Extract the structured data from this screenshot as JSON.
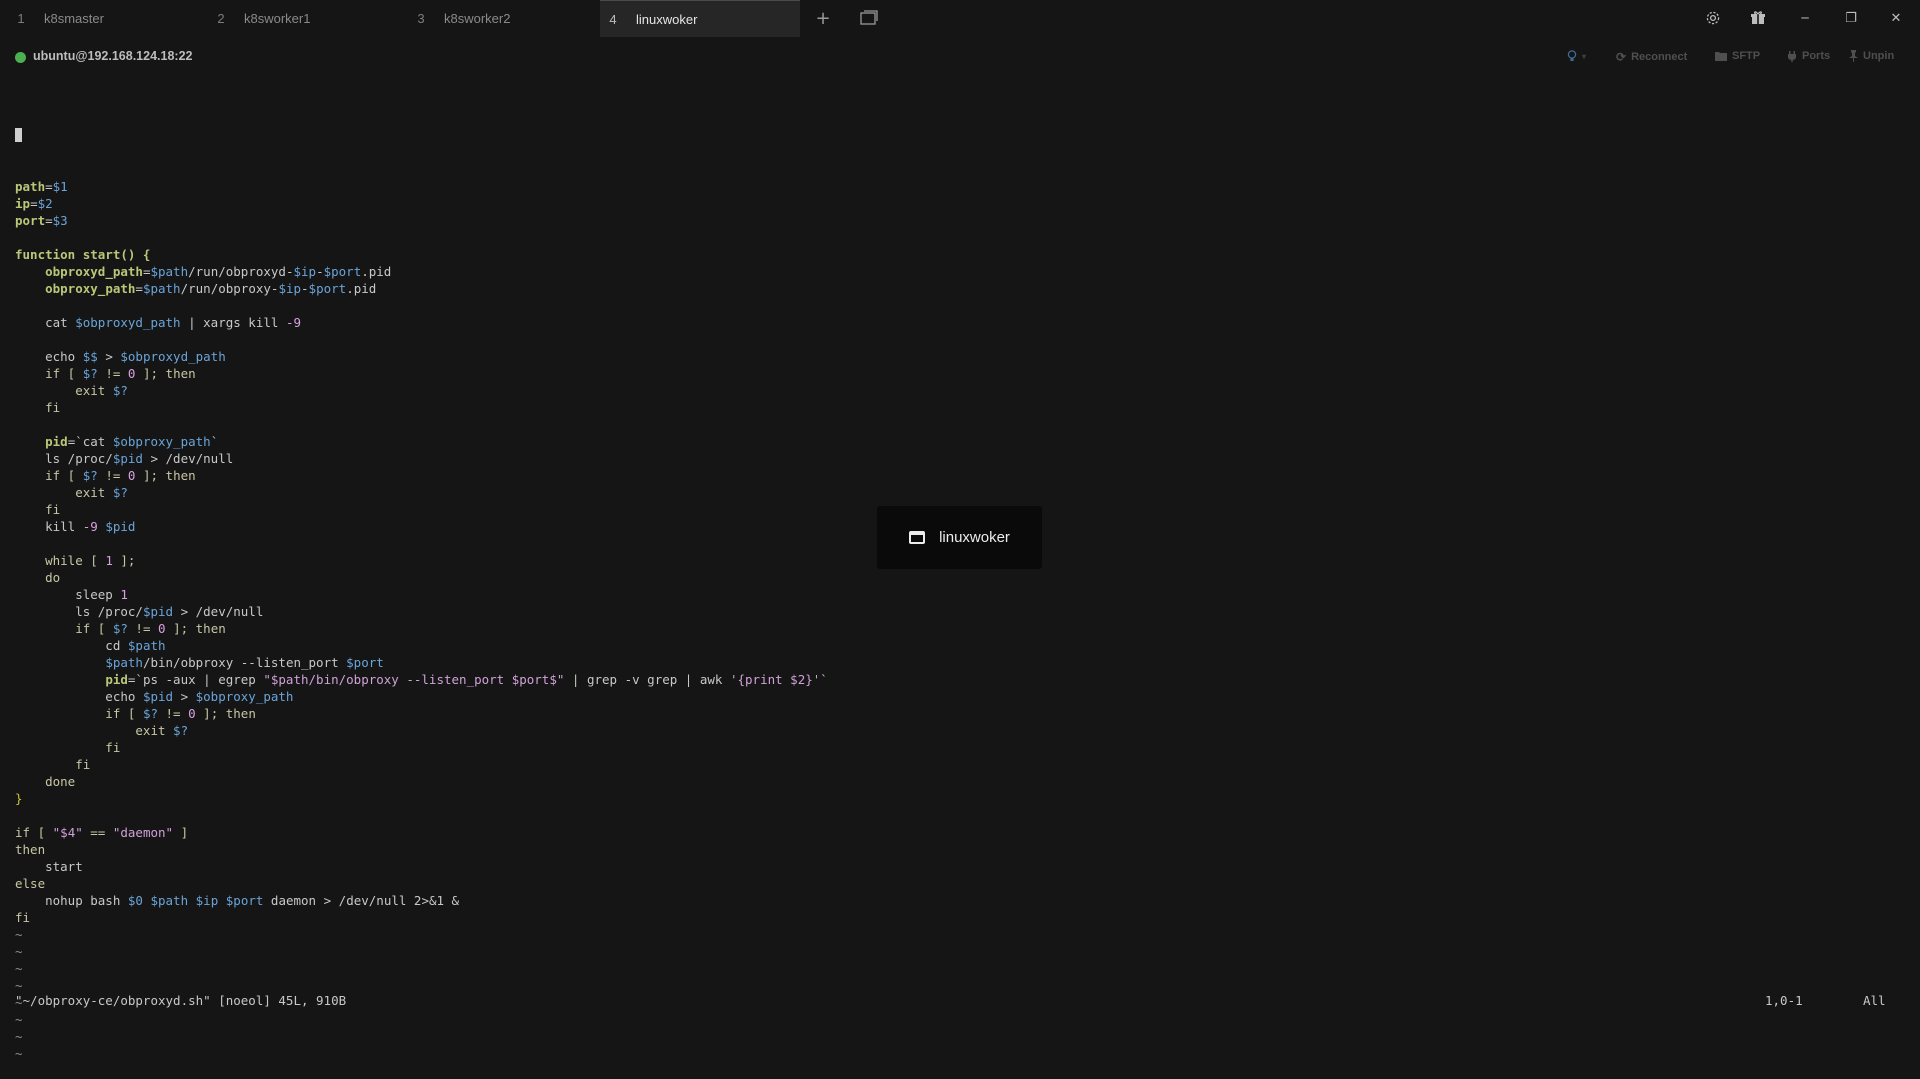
{
  "tabs": [
    {
      "num": "1",
      "label": "k8smaster",
      "active": false
    },
    {
      "num": "2",
      "label": "k8sworker1",
      "active": false
    },
    {
      "num": "3",
      "label": "k8sworker2",
      "active": false
    },
    {
      "num": "4",
      "label": "linuxwoker",
      "active": true
    }
  ],
  "toolbar": {
    "new_tab": "+",
    "split": "⧉"
  },
  "window_controls": {
    "settings_icon": "gear-icon",
    "gift_icon": "gift-icon",
    "minimize": "─",
    "restore": "❐",
    "close": "✕"
  },
  "session": {
    "host": "ubuntu@192.168.124.18:22",
    "status_color": "#4caf50",
    "reconnect": "Reconnect",
    "sftp": "SFTP",
    "ports": "Ports",
    "unpin": "Unpin"
  },
  "terminal": {
    "lines": [
      [
        {
          "t": "path",
          "c": "var"
        },
        {
          "t": "=",
          "c": "cmd"
        },
        {
          "t": "$1",
          "c": "dv"
        }
      ],
      [
        {
          "t": "ip",
          "c": "var"
        },
        {
          "t": "=",
          "c": "cmd"
        },
        {
          "t": "$2",
          "c": "dv"
        }
      ],
      [
        {
          "t": "port",
          "c": "var"
        },
        {
          "t": "=",
          "c": "cmd"
        },
        {
          "t": "$3",
          "c": "dv"
        }
      ],
      [],
      [
        {
          "t": "function start() {",
          "c": "var"
        }
      ],
      [
        {
          "t": "    ",
          "c": "cmd"
        },
        {
          "t": "obproxyd_path",
          "c": "var"
        },
        {
          "t": "=",
          "c": "cmd"
        },
        {
          "t": "$path",
          "c": "dv"
        },
        {
          "t": "/run/obproxyd-",
          "c": "cmd"
        },
        {
          "t": "$ip",
          "c": "dv"
        },
        {
          "t": "-",
          "c": "cmd"
        },
        {
          "t": "$port",
          "c": "dv"
        },
        {
          "t": ".pid",
          "c": "cmd"
        }
      ],
      [
        {
          "t": "    ",
          "c": "cmd"
        },
        {
          "t": "obproxy_path",
          "c": "var"
        },
        {
          "t": "=",
          "c": "cmd"
        },
        {
          "t": "$path",
          "c": "dv"
        },
        {
          "t": "/run/obproxy-",
          "c": "cmd"
        },
        {
          "t": "$ip",
          "c": "dv"
        },
        {
          "t": "-",
          "c": "cmd"
        },
        {
          "t": "$port",
          "c": "dv"
        },
        {
          "t": ".pid",
          "c": "cmd"
        }
      ],
      [],
      [
        {
          "t": "    cat ",
          "c": "cmd"
        },
        {
          "t": "$obproxyd_path",
          "c": "dv"
        },
        {
          "t": " | xargs kill ",
          "c": "cmd"
        },
        {
          "t": "-9",
          "c": "num"
        }
      ],
      [],
      [
        {
          "t": "    echo ",
          "c": "cmd"
        },
        {
          "t": "$$",
          "c": "dv"
        },
        {
          "t": " > ",
          "c": "cmd"
        },
        {
          "t": "$obproxyd_path",
          "c": "dv"
        }
      ],
      [
        {
          "t": "    if [ ",
          "c": "kw"
        },
        {
          "t": "$?",
          "c": "dv"
        },
        {
          "t": " != ",
          "c": "kw"
        },
        {
          "t": "0",
          "c": "num"
        },
        {
          "t": " ]; then",
          "c": "kw"
        }
      ],
      [
        {
          "t": "        exit ",
          "c": "kw"
        },
        {
          "t": "$?",
          "c": "dv"
        }
      ],
      [
        {
          "t": "    fi",
          "c": "kw"
        }
      ],
      [],
      [
        {
          "t": "    ",
          "c": "cmd"
        },
        {
          "t": "pid",
          "c": "var"
        },
        {
          "t": "=`cat ",
          "c": "cmd"
        },
        {
          "t": "$obproxy_path",
          "c": "dv"
        },
        {
          "t": "`",
          "c": "cmd"
        }
      ],
      [
        {
          "t": "    ls /proc/",
          "c": "cmd"
        },
        {
          "t": "$pid",
          "c": "dv"
        },
        {
          "t": " > /dev/null",
          "c": "cmd"
        }
      ],
      [
        {
          "t": "    if [ ",
          "c": "kw"
        },
        {
          "t": "$?",
          "c": "dv"
        },
        {
          "t": " != ",
          "c": "kw"
        },
        {
          "t": "0",
          "c": "num"
        },
        {
          "t": " ]; then",
          "c": "kw"
        }
      ],
      [
        {
          "t": "        exit ",
          "c": "kw"
        },
        {
          "t": "$?",
          "c": "dv"
        }
      ],
      [
        {
          "t": "    fi",
          "c": "kw"
        }
      ],
      [
        {
          "t": "    kill ",
          "c": "cmd"
        },
        {
          "t": "-9",
          "c": "num"
        },
        {
          "t": " ",
          "c": "cmd"
        },
        {
          "t": "$pid",
          "c": "dv"
        }
      ],
      [],
      [
        {
          "t": "    while [ ",
          "c": "kw"
        },
        {
          "t": "1",
          "c": "num"
        },
        {
          "t": " ];",
          "c": "kw"
        }
      ],
      [
        {
          "t": "    do",
          "c": "kw"
        }
      ],
      [
        {
          "t": "        sleep ",
          "c": "cmd"
        },
        {
          "t": "1",
          "c": "num"
        }
      ],
      [
        {
          "t": "        ls /proc/",
          "c": "cmd"
        },
        {
          "t": "$pid",
          "c": "dv"
        },
        {
          "t": " > /dev/null",
          "c": "cmd"
        }
      ],
      [
        {
          "t": "        if [ ",
          "c": "kw"
        },
        {
          "t": "$?",
          "c": "dv"
        },
        {
          "t": " != ",
          "c": "kw"
        },
        {
          "t": "0",
          "c": "num"
        },
        {
          "t": " ]; then",
          "c": "kw"
        }
      ],
      [
        {
          "t": "            cd ",
          "c": "cmd"
        },
        {
          "t": "$path",
          "c": "dv"
        }
      ],
      [
        {
          "t": "            ",
          "c": "cmd"
        },
        {
          "t": "$path",
          "c": "dv"
        },
        {
          "t": "/bin/obproxy --listen_port ",
          "c": "cmd"
        },
        {
          "t": "$port",
          "c": "dv"
        }
      ],
      [
        {
          "t": "            ",
          "c": "cmd"
        },
        {
          "t": "pid",
          "c": "var"
        },
        {
          "t": "=`ps -aux | egrep ",
          "c": "cmd"
        },
        {
          "t": "\"$path/bin/obproxy --listen_port $port$\"",
          "c": "str"
        },
        {
          "t": " | grep -v grep | awk ",
          "c": "cmd"
        },
        {
          "t": "'{print $2}'",
          "c": "str"
        },
        {
          "t": "`",
          "c": "cmd"
        }
      ],
      [
        {
          "t": "            echo ",
          "c": "cmd"
        },
        {
          "t": "$pid",
          "c": "dv"
        },
        {
          "t": " > ",
          "c": "cmd"
        },
        {
          "t": "$obproxy_path",
          "c": "dv"
        }
      ],
      [
        {
          "t": "            if [ ",
          "c": "kw"
        },
        {
          "t": "$?",
          "c": "dv"
        },
        {
          "t": " != ",
          "c": "kw"
        },
        {
          "t": "0",
          "c": "num"
        },
        {
          "t": " ]; then",
          "c": "kw"
        }
      ],
      [
        {
          "t": "                exit ",
          "c": "kw"
        },
        {
          "t": "$?",
          "c": "dv"
        }
      ],
      [
        {
          "t": "            fi",
          "c": "kw"
        }
      ],
      [
        {
          "t": "        fi",
          "c": "kw"
        }
      ],
      [
        {
          "t": "    done",
          "c": "kw"
        }
      ],
      [
        {
          "t": "}",
          "c": "brace"
        }
      ],
      [],
      [
        {
          "t": "if [ ",
          "c": "kw"
        },
        {
          "t": "\"$4\"",
          "c": "str"
        },
        {
          "t": " == ",
          "c": "kw"
        },
        {
          "t": "\"daemon\"",
          "c": "str"
        },
        {
          "t": " ]",
          "c": "kw"
        }
      ],
      [
        {
          "t": "then",
          "c": "kw"
        }
      ],
      [
        {
          "t": "    start",
          "c": "cmd"
        }
      ],
      [
        {
          "t": "else",
          "c": "kw"
        }
      ],
      [
        {
          "t": "    nohup bash ",
          "c": "cmd"
        },
        {
          "t": "$0",
          "c": "dv"
        },
        {
          "t": " ",
          "c": "cmd"
        },
        {
          "t": "$path",
          "c": "dv"
        },
        {
          "t": " ",
          "c": "cmd"
        },
        {
          "t": "$ip",
          "c": "dv"
        },
        {
          "t": " ",
          "c": "cmd"
        },
        {
          "t": "$port",
          "c": "dv"
        },
        {
          "t": " daemon > /dev/null 2>&1 &",
          "c": "cmd"
        }
      ],
      [
        {
          "t": "fi",
          "c": "kw"
        }
      ],
      [
        {
          "t": "~",
          "c": "tilde"
        }
      ],
      [
        {
          "t": "~",
          "c": "tilde"
        }
      ],
      [
        {
          "t": "~",
          "c": "tilde"
        }
      ],
      [
        {
          "t": "~",
          "c": "tilde"
        }
      ],
      [
        {
          "t": "~",
          "c": "tilde"
        }
      ],
      [
        {
          "t": "~",
          "c": "tilde"
        }
      ],
      [
        {
          "t": "~",
          "c": "tilde"
        }
      ],
      [
        {
          "t": "~",
          "c": "tilde"
        }
      ]
    ],
    "status_left": "\"~/obproxy-ce/obproxyd.sh\" [noeol] 45L, 910B",
    "status_pos": "1,0-1",
    "status_scroll": "All"
  },
  "overlay": {
    "label": "linuxwoker"
  }
}
